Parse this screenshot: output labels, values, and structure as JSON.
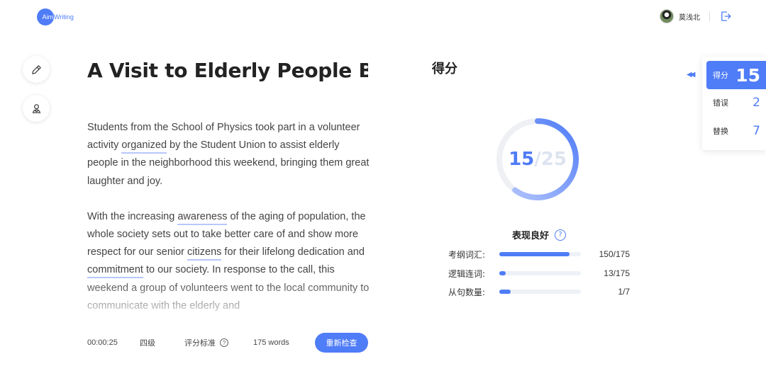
{
  "header": {
    "logo_circle": "Aim",
    "logo_rest": "Writing",
    "username": "莫浅北"
  },
  "tools": {
    "edit_icon": "pencil-icon",
    "user_icon": "user-icon"
  },
  "essay": {
    "title": "A Visit to Elderly People Bringing Them Great Laughter and Joy",
    "paragraphs": [
      [
        {
          "t": "Students from the School of Physics took part in a volunteer activity "
        },
        {
          "t": "organized",
          "hl": true
        },
        {
          "t": " by the Student Union to assist elderly people in the neighborhood this weekend, bringing them great laughter and joy."
        }
      ],
      [
        {
          "t": "With the increasing "
        },
        {
          "t": "awareness",
          "hl": true
        },
        {
          "t": " of the aging of population, the whole society sets out to take better care of and show more respect for our senior "
        },
        {
          "t": "citizens",
          "hl": true
        },
        {
          "t": " for their lifelong dedication and "
        },
        {
          "t": "commitment",
          "hl": true
        },
        {
          "t": " to our society. In response to the call, this weekend a group of volunteers went to the local community to communicate with the elderly and"
        }
      ]
    ]
  },
  "footer": {
    "time": "00:00:25",
    "level": "四级",
    "standard": "评分标准",
    "words": "175 words",
    "recheck_button": "重新检查"
  },
  "score": {
    "heading": "得分",
    "value": "15",
    "separator": "/",
    "total": "25",
    "ring_fraction": 0.6,
    "performance": "表现良好",
    "metrics": [
      {
        "label": "考纲词汇:",
        "value": "150/175",
        "fraction": 0.857
      },
      {
        "label": "逻辑连词:",
        "value": "13/175",
        "fraction": 0.074
      },
      {
        "label": "从句数量:",
        "value": "1/7",
        "fraction": 0.143
      }
    ]
  },
  "side_tabs": [
    {
      "label": "得分",
      "count": "15",
      "active": true
    },
    {
      "label": "错误",
      "count": "2",
      "active": false
    },
    {
      "label": "替换",
      "count": "7",
      "active": false
    }
  ],
  "colors": {
    "accent": "#4f7cf7"
  }
}
